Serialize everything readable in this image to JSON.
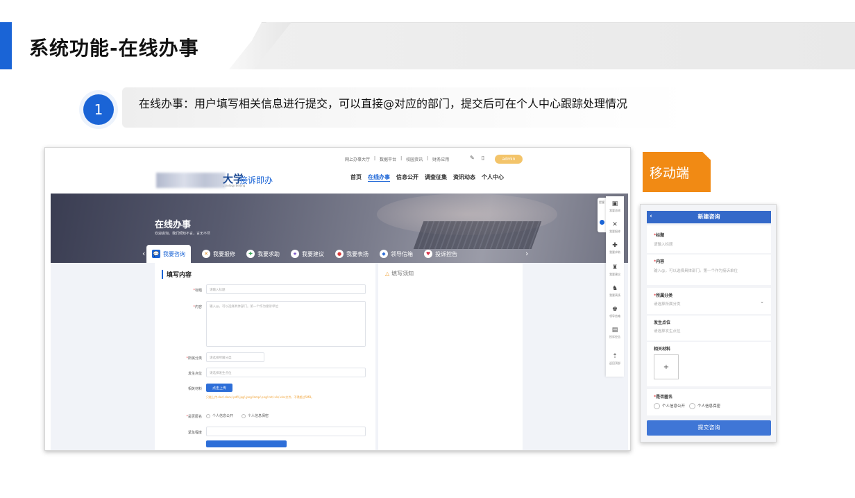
{
  "slide": {
    "title": "系统功能-在线办事",
    "step_number": "1",
    "step_text": "在线办事：用户填写相关信息进行提交，可以直接@对应的部门，提交后可在个人中心跟踪处理情况"
  },
  "colors": {
    "accent_blue": "#1a64d6",
    "mobile_label_orange": "#f18a14",
    "required_red": "#e5484d",
    "hint_orange": "#f0a43a"
  },
  "desktop": {
    "top_links": [
      "网上办事大厅",
      "|",
      "数据平台",
      "|",
      "校园资讯",
      "|",
      "财务应用"
    ],
    "user_pill": "admin",
    "logo_university": "大学",
    "logo_sub": "...nology Beijing",
    "logo_name": "接诉即办",
    "nav": [
      "首页",
      "在线办事",
      "信息公开",
      "调查征集",
      "资讯动态",
      "个人中心"
    ],
    "nav_active": "在线办事",
    "hero": {
      "title": "在线办事",
      "subtitle": "欢迎咨询。我们倾知不言，言无不尽",
      "tabs": [
        {
          "label": "我要咨询",
          "icon": "chat-icon",
          "glyph": "💬"
        },
        {
          "label": "我要报修",
          "icon": "tools-icon",
          "glyph": "✕"
        },
        {
          "label": "我要求助",
          "icon": "help-icon",
          "glyph": "✚"
        },
        {
          "label": "我要建议",
          "icon": "idea-icon",
          "glyph": "★"
        },
        {
          "label": "我要表扬",
          "icon": "medal-icon",
          "glyph": "●"
        },
        {
          "label": "领导信箱",
          "icon": "mailbox-icon",
          "glyph": "◆"
        },
        {
          "label": "投诉控告",
          "icon": "complaint-icon",
          "glyph": "♥"
        }
      ],
      "prev_arrow": "‹",
      "next_arrow": "›"
    },
    "form": {
      "title": "填写内容",
      "fields": {
        "title_label": "标题",
        "title_placeholder": "请输入标题",
        "content_label": "内容",
        "content_placeholder": "输入@，可以选择具体部门。第一个作为接诉单位",
        "category_label": "所属分类",
        "category_placeholder": "请选择所属分类",
        "location_label": "发生点位",
        "location_placeholder": "请选择发生点位",
        "material_label": "相关材料",
        "upload_button": "点击上传",
        "upload_hint": "只能上传.doc/.docx/.pdf/.jpg/.jpeg/.bmp/.png/.txt/.xls/.xlsx文件，不得超过5MB。",
        "anonymous_label": "是否匿名",
        "anonymous_options": [
          "个人信息公开",
          "个人信息保密"
        ],
        "urgency_label": "紧急程度"
      }
    },
    "notice": {
      "title": "填写须知"
    },
    "sidebar": [
      {
        "label": "我要咨询",
        "glyph": "▣"
      },
      {
        "label": "我要报修",
        "glyph": "✕"
      },
      {
        "label": "我要求助",
        "glyph": "✚"
      },
      {
        "label": "我要建议",
        "glyph": "♜"
      },
      {
        "label": "我要表扬",
        "glyph": "♞"
      },
      {
        "label": "领导信箱",
        "glyph": "♚"
      },
      {
        "label": "投诉控告",
        "glyph": "▤"
      },
      {
        "label": "返回顶部",
        "glyph": "⇡"
      }
    ],
    "side_tab": "提醒"
  },
  "mobile": {
    "label": "移动端",
    "header": "新建咨询",
    "back": "‹",
    "title_label": "标题",
    "title_placeholder": "请输入标题",
    "content_label": "内容",
    "content_placeholder": "输入@，可以选择具体部门。第一个作为接诉单位",
    "category_label": "所属分类",
    "category_placeholder": "请选择所属分类",
    "location_label": "发生点位",
    "location_placeholder": "请选择发生点位",
    "material_label": "相关材料",
    "add_glyph": "+",
    "anonymous_label": "是否匿名",
    "anonymous_options": [
      "个人信息公开",
      "个人信息保密"
    ],
    "submit": "提交咨询"
  }
}
